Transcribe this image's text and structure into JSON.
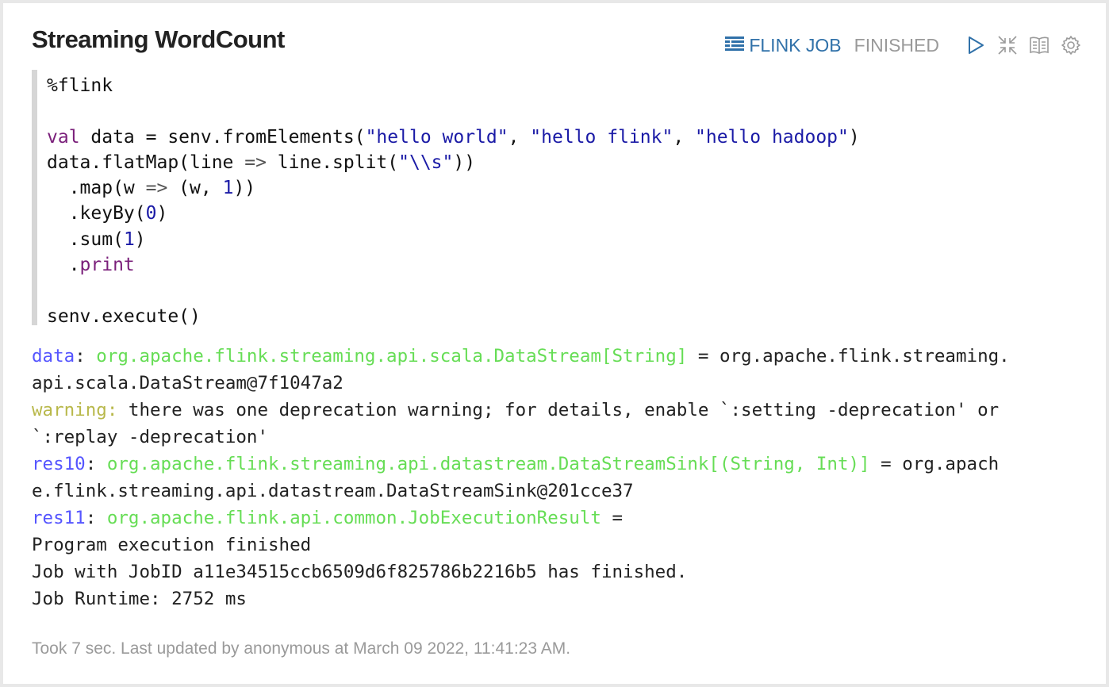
{
  "paragraph": {
    "title": "Streaming WordCount",
    "job_link_label": "FLINK JOB",
    "status": "FINISHED"
  },
  "code": {
    "magic": "%flink",
    "line2_kw": "val",
    "line2_a": " data = senv.fromElements(",
    "line2_s1": "\"hello world\"",
    "line2_c1": ", ",
    "line2_s2": "\"hello flink\"",
    "line2_c2": ", ",
    "line2_s3": "\"hello hadoop\"",
    "line2_end": ")",
    "line3_a": "data.flatMap(line ",
    "line3_arrow": "=>",
    "line3_b": " line.split(",
    "line3_s": "\"\\\\s\"",
    "line3_end": "))",
    "line4_a": "  .map(w ",
    "line4_arrow": "=>",
    "line4_b": " (w, ",
    "line4_n": "1",
    "line4_end": "))",
    "line5_a": "  .keyBy(",
    "line5_n": "0",
    "line5_end": ")",
    "line6_a": "  .sum(",
    "line6_n": "1",
    "line6_end": ")",
    "line7_dot": "  .",
    "line7_kw": "print",
    "line9": "senv.execute()"
  },
  "output": {
    "l1_var": "data",
    "l1_colon": ": ",
    "l1_type": "org.apache.flink.streaming.api.scala.DataStream[String]",
    "l1_rest": " = org.apache.flink.streaming.",
    "l2": "api.scala.DataStream@7f1047a2",
    "l3_warn": "warning:",
    "l3_rest": " there was one deprecation warning; for details, enable `:setting -deprecation' or",
    "l4": "`:replay -deprecation'",
    "l5_var": "res10",
    "l5_colon": ": ",
    "l5_type": "org.apache.flink.streaming.api.datastream.DataStreamSink[(String, Int)]",
    "l5_rest": " = org.apach",
    "l6": "e.flink.streaming.api.datastream.DataStreamSink@201cce37",
    "l7_var": "res11",
    "l7_colon": ": ",
    "l7_type": "org.apache.flink.api.common.JobExecutionResult",
    "l7_rest": " =",
    "l8": "Program execution finished",
    "l9": "Job with JobID a11e34515ccb6509d6f825786b2216b5 has finished.",
    "l10": "Job Runtime: 2752 ms"
  },
  "footer": "Took 7 sec. Last updated by anonymous at March 09 2022, 11:41:23 AM.",
  "icons": {
    "job": "list-icon",
    "run": "play-icon",
    "collapse": "compress-icon",
    "book": "book-icon",
    "settings": "gear-icon"
  },
  "colors": {
    "link": "#3071a9",
    "status": "#9a9a9a",
    "var": "#5555ff",
    "type": "#66dd55",
    "warning": "#b8b84a"
  }
}
